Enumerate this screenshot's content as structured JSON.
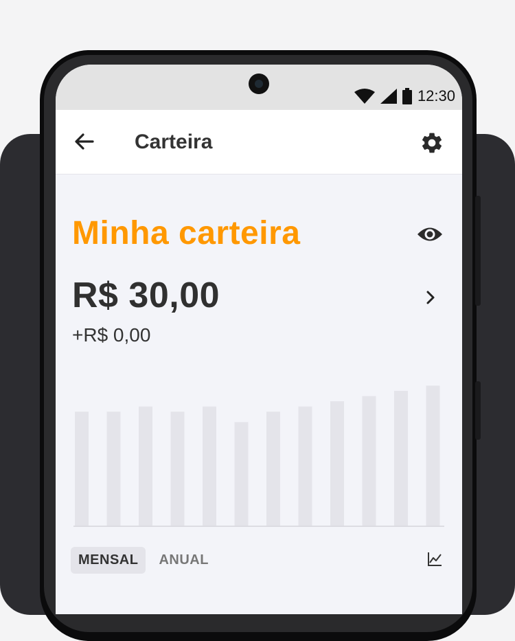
{
  "status_bar": {
    "time": "12:30"
  },
  "app_bar": {
    "title": "Carteira"
  },
  "wallet": {
    "title": "Minha carteira",
    "balance": "R$ 30,00",
    "change": "+R$ 0,00"
  },
  "tabs": [
    {
      "label": "MENSAL",
      "active": true
    },
    {
      "label": "ANUAL",
      "active": false
    }
  ],
  "colors": {
    "accent": "#ff9800",
    "bar": "#e4e4ea",
    "text": "#303030"
  },
  "icons": [
    "back-arrow-icon",
    "gear-icon",
    "eye-icon",
    "chevron-right-icon",
    "line-chart-icon",
    "wifi-icon",
    "signal-icon",
    "battery-icon"
  ],
  "chart_data": {
    "type": "bar",
    "values": [
      22,
      22,
      23,
      22,
      23,
      20,
      22,
      23,
      24,
      25,
      26,
      27
    ],
    "ylim": [
      0,
      31
    ],
    "grid": false
  }
}
